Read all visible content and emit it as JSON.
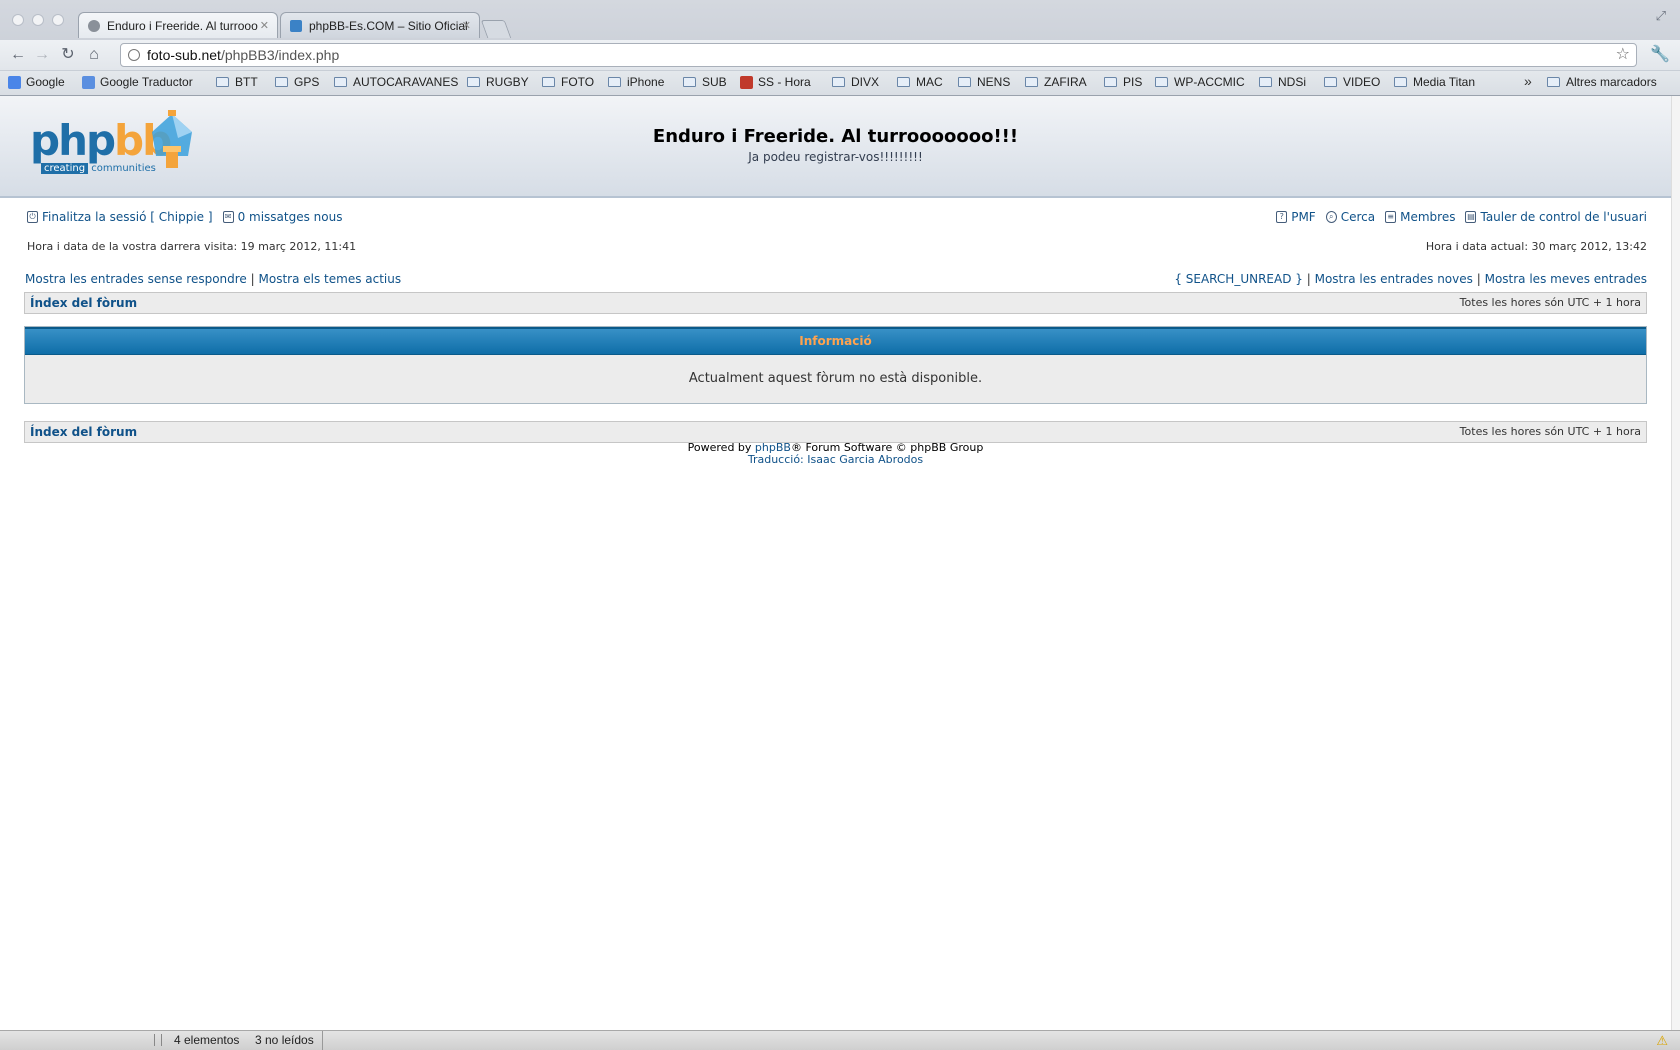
{
  "browser": {
    "tabs": [
      {
        "title": "Enduro i Freeride. Al turrooo",
        "active": true
      },
      {
        "title": "phpBB-Es.COM – Sitio Oficial",
        "active": false
      }
    ],
    "url_host": "foto-sub.net",
    "url_path": "/phpBB3/index.php",
    "bookmarks": [
      {
        "label": "Google",
        "icon": "google-icon"
      },
      {
        "label": "Google Traductor",
        "icon": "translate-icon"
      },
      {
        "label": "BTT",
        "icon": "folder-icon"
      },
      {
        "label": "GPS",
        "icon": "folder-icon"
      },
      {
        "label": "AUTOCARAVANES",
        "icon": "folder-icon"
      },
      {
        "label": "RUGBY",
        "icon": "folder-icon"
      },
      {
        "label": "FOTO",
        "icon": "folder-icon"
      },
      {
        "label": "iPhone",
        "icon": "folder-icon"
      },
      {
        "label": "SUB",
        "icon": "folder-icon"
      },
      {
        "label": "SS - Hora",
        "icon": "gencat-icon"
      },
      {
        "label": "DIVX",
        "icon": "folder-icon"
      },
      {
        "label": "MAC",
        "icon": "folder-icon"
      },
      {
        "label": "NENS",
        "icon": "folder-icon"
      },
      {
        "label": "ZAFIRA",
        "icon": "folder-icon"
      },
      {
        "label": "PIS",
        "icon": "folder-icon"
      },
      {
        "label": "WP-ACCMIC",
        "icon": "folder-icon"
      },
      {
        "label": "NDSi",
        "icon": "folder-icon"
      },
      {
        "label": "VIDEO",
        "icon": "folder-icon"
      },
      {
        "label": "Media Titan",
        "icon": "folder-icon"
      }
    ],
    "more_bookmarks": "»",
    "other_bookmarks": "Altres marcadors"
  },
  "forum": {
    "logo": {
      "word_php": "php",
      "word_bb": "bb",
      "tagline_a": "creating",
      "tagline_b": "communities"
    },
    "site_title": "Enduro i Freeride. Al turrooooooo!!!",
    "site_desc": "Ja podeu registrar-vos!!!!!!!!!",
    "logout": "Finalitza la sessió [ Chippie ]",
    "messages": "0 missatges nous",
    "faq": "PMF",
    "search": "Cerca",
    "members": "Membres",
    "ucp": "Tauler de control de l'usuari",
    "last_visit": "Hora i data de la vostra darrera visita: 19 març 2012, 11:41",
    "current_time": "Hora i data actual: 30 març 2012, 13:42",
    "unanswered": "Mostra les entrades sense respondre",
    "active_topics": "Mostra els temes actius",
    "search_unread": "{ SEARCH_UNREAD }",
    "new_posts": "Mostra les entrades noves",
    "own_posts": "Mostra les meves entrades",
    "separator": "|",
    "index_link": "Índex del fòrum",
    "timezone": "Totes les hores són UTC + 1 hora",
    "info_title": "Informació",
    "info_message": "Actualment aquest fòrum no està disponible.",
    "powered_pre": "Powered by ",
    "powered_link": "phpBB",
    "powered_post": "® Forum Software © phpBB Group",
    "translation": "Traducció: Isaac Garcia Abrodos"
  },
  "statusbar": {
    "items": "4 elementos",
    "unread": "3 no leídos"
  },
  "colors": {
    "link": "#105289",
    "info_header": "#0f6ea8",
    "info_title": "#ffa34f",
    "logo_blue": "#1f6fa8",
    "logo_orange": "#f4a43b"
  }
}
